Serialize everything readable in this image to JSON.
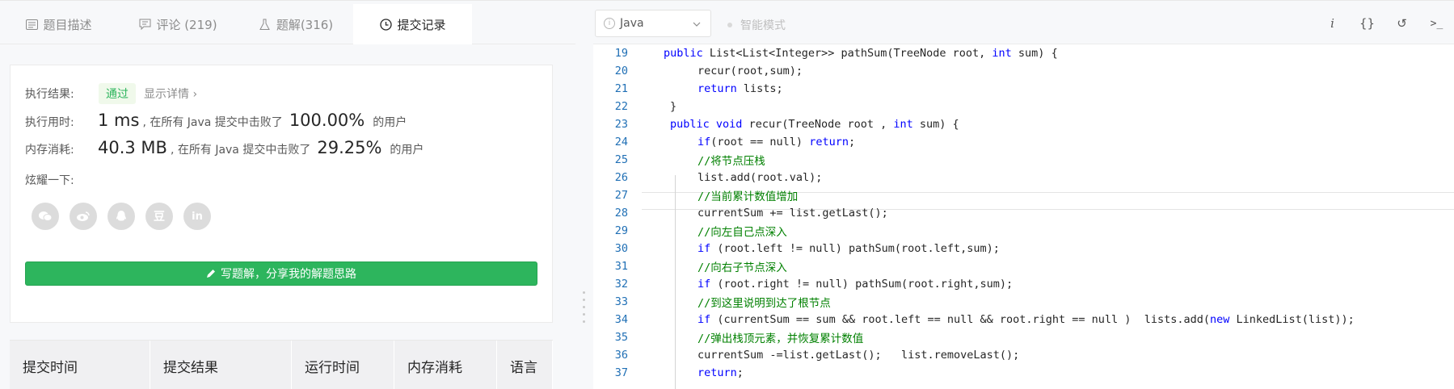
{
  "tabs": [
    {
      "label": "题目描述",
      "icon": "document-icon"
    },
    {
      "label": "评论 (219)",
      "icon": "comment-icon"
    },
    {
      "label": "题解(316)",
      "icon": "flask-icon"
    },
    {
      "label": "提交记录",
      "icon": "history-icon"
    }
  ],
  "result": {
    "exec_label": "执行结果:",
    "status": "通过",
    "detail_link": "显示详情 ›",
    "time_label": "执行用时:",
    "time_value": "1 ms",
    "time_text": ", 在所有 Java 提交中击败了",
    "time_pct": "100.00%",
    "time_suffix": "的用户",
    "mem_label": "内存消耗:",
    "mem_value": "40.3 MB",
    "mem_text": ", 在所有 Java 提交中击败了",
    "mem_pct": "29.25%",
    "mem_suffix": "的用户",
    "share_label": "炫耀一下:",
    "share_icons": [
      "wechat-icon",
      "weibo-icon",
      "qq-icon",
      "douban-icon",
      "linkedin-icon"
    ],
    "douban_glyph": "豆",
    "linkedin_glyph": "in",
    "write_button": "写题解，分享我的解题思路"
  },
  "table": {
    "headers": [
      "提交时间",
      "提交结果",
      "运行时间",
      "内存消耗",
      "语言"
    ]
  },
  "toolbar": {
    "language": "Java",
    "smart_mode": "智能模式",
    "tools": [
      "i",
      "{}",
      "↺",
      ">_"
    ]
  },
  "editor": {
    "lines": [
      {
        "n": "19",
        "indent": 0,
        "code": "public List<List<Integer>> pathSum(TreeNode root, int sum) {"
      },
      {
        "n": "20",
        "indent": 1,
        "code": "recur(root,sum);"
      },
      {
        "n": "21",
        "indent": 1,
        "code": "return lists;"
      },
      {
        "n": "22",
        "indent": 2,
        "code": "}"
      },
      {
        "n": "23",
        "indent": 3,
        "code": "public void recur(TreeNode root , int sum) {"
      },
      {
        "n": "24",
        "indent": 1,
        "code": "if(root == null) return;"
      },
      {
        "n": "25",
        "indent": 1,
        "code": "//将节点压栈"
      },
      {
        "n": "26",
        "indent": 1,
        "code": "list.add(root.val);"
      },
      {
        "n": "27",
        "indent": 1,
        "code": "//当前累计数值增加"
      },
      {
        "n": "28",
        "indent": 1,
        "code": "currentSum += list.getLast();"
      },
      {
        "n": "29",
        "indent": 1,
        "code": "//向左自己点深入"
      },
      {
        "n": "30",
        "indent": 1,
        "code": "if (root.left != null) pathSum(root.left,sum);"
      },
      {
        "n": "31",
        "indent": 1,
        "code": "//向右子节点深入"
      },
      {
        "n": "32",
        "indent": 1,
        "code": "if (root.right != null) pathSum(root.right,sum);"
      },
      {
        "n": "33",
        "indent": 1,
        "code": "//到这里说明到达了根节点"
      },
      {
        "n": "34",
        "indent": 1,
        "code": "if (currentSum == sum && root.left == null && root.right == null )  lists.add(new LinkedList(list));"
      },
      {
        "n": "35",
        "indent": 1,
        "code": "//弹出栈顶元素，并恢复累计数值"
      },
      {
        "n": "36",
        "indent": 1,
        "code": "currentSum -=list.getLast();   list.removeLast();"
      },
      {
        "n": "37",
        "indent": 1,
        "code": "return;"
      }
    ],
    "current_line": "25"
  }
}
